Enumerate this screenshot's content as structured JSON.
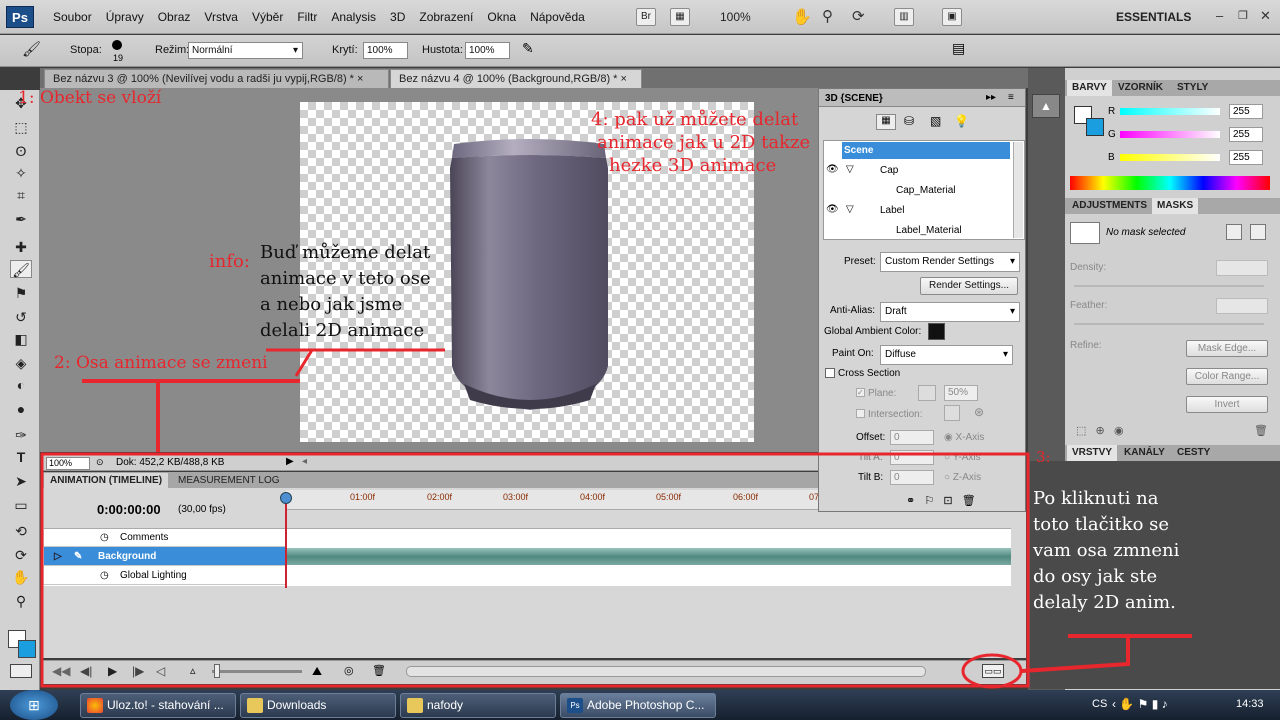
{
  "menu": {
    "logo": "Ps",
    "items": [
      "Soubor",
      "Úpravy",
      "Obraz",
      "Vrstva",
      "Výběr",
      "Filtr",
      "Analysis",
      "3D",
      "Zobrazení",
      "Okna",
      "Nápověda"
    ],
    "bridge_label": "Br",
    "zoom": "100%",
    "workspace": "ESSENTIALS"
  },
  "options": {
    "brush_label": "Stopa:",
    "brush_size": "19",
    "mode_label": "Režim:",
    "mode_value": "Normální",
    "opacity_label": "Krytí:",
    "opacity_value": "100%",
    "flow_label": "Hustota:",
    "flow_value": "100%"
  },
  "doc_tabs": [
    {
      "label": "Bez názvu 3 @ 100% (Nevilívej vodu a radši ju vypij,RGB/8) *",
      "active": false
    },
    {
      "label": "Bez názvu 4 @ 100% (Background,RGB/8) *",
      "active": true
    }
  ],
  "tab_close": "×",
  "status": {
    "zoom": "100%",
    "doc": "Dok: 452,2 KB/488,8 KB"
  },
  "timeline": {
    "tabs": [
      "ANIMATION (TIMELINE)",
      "MEASUREMENT LOG"
    ],
    "timecode": "0:00:00:00",
    "fps": "(30,00 fps)",
    "ticks": [
      "01:00f",
      "02:00f",
      "03:00f",
      "04:00f",
      "05:00f",
      "06:00f",
      "07"
    ],
    "rows": [
      {
        "label": "Comments",
        "selected": false
      },
      {
        "label": "Background",
        "selected": true
      },
      {
        "label": "Global Lighting",
        "selected": false
      }
    ]
  },
  "panel3d": {
    "title": "3D {SCENE}",
    "tree": [
      {
        "label": "Scene",
        "selected": true
      },
      {
        "label": "Cap"
      },
      {
        "label": "Cap_Material"
      },
      {
        "label": "Label"
      },
      {
        "label": "Label_Material"
      }
    ],
    "preset_label": "Preset:",
    "preset_value": "Custom Render Settings",
    "render_btn": "Render Settings...",
    "antialias_label": "Anti-Alias:",
    "antialias_value": "Draft",
    "ambient_label": "Global Ambient Color:",
    "painton_label": "Paint On:",
    "painton_value": "Diffuse",
    "cross_label": "Cross Section",
    "plane_label": "Plane:",
    "plane_value": "50%",
    "intersection_label": "Intersection:",
    "offset_label": "Offset:",
    "offset_value": "0",
    "offset_axis": "X-Axis",
    "tilta_label": "Tilt A:",
    "tilta_value": "0",
    "tilta_axis": "Y-Axis",
    "tiltb_label": "Tilt B:",
    "tiltb_value": "0",
    "tiltb_axis": "Z-Axis"
  },
  "color_panel": {
    "tabs": [
      "BARVY",
      "VZORNÍK",
      "STYLY"
    ],
    "r_label": "R",
    "r_value": "255",
    "g_label": "G",
    "g_value": "255",
    "b_label": "B",
    "b_value": "255"
  },
  "masks_panel": {
    "tabs": [
      "ADJUSTMENTS",
      "MASKS"
    ],
    "status": "No mask selected",
    "density_label": "Density:",
    "feather_label": "Feather:",
    "refine_label": "Refine:",
    "mask_edge_btn": "Mask Edge...",
    "color_range_btn": "Color Range...",
    "invert_btn": "Invert"
  },
  "layers_panel": {
    "tabs": [
      "VRSTVY",
      "KANÁLY",
      "CESTY"
    ]
  },
  "annotations": {
    "a1": "1: Obekt se vloží",
    "a2": "2: Osa animace se zmeni",
    "a3": "3:",
    "a4_line1": "4: pak už můžete delat",
    "a4_line2": "animace jak u 2D takze",
    "a4_line3": "hezke 3D animace",
    "info_label": "info:",
    "info_line1": "Buď můžeme delat",
    "info_line2": "animace v teto ose",
    "info_line3": "a nebo jak jsme",
    "info_line4": "delali 2D animace",
    "p_line1": "Po kliknuti na",
    "p_line2": "toto tlačitko se",
    "p_line3": "vam osa zmneni",
    "p_line4": "do osy jak ste",
    "p_line5": "delaly 2D anim."
  },
  "taskbar": {
    "items": [
      "Uloz.to! - stahování ...",
      "Downloads",
      "nafody",
      "Adobe Photoshop C..."
    ],
    "lang": "CS",
    "time": "14:33"
  },
  "colors": {
    "accent_red": "#e8262d",
    "selection_blue": "#3a8ed9",
    "fg_color": "#ffffff",
    "bg_color": "#1b9ee0"
  }
}
